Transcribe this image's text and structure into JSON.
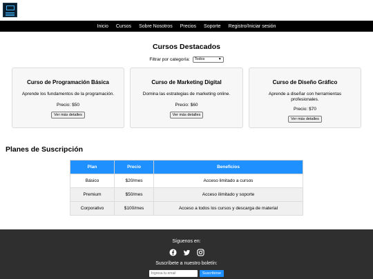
{
  "header": {
    "nav": [
      "Inicio",
      "Cursos",
      "Sobre Nosotros",
      "Precios",
      "Soporte",
      "Registro/Iniciar sesión"
    ]
  },
  "courses": {
    "title": "Cursos Destacados",
    "filter_label": "Filtrar por categoría:",
    "filter_value": "Todos",
    "cards": [
      {
        "title": "Curso de Programación Básica",
        "desc": "Aprende los fundamentos de la programación.",
        "price": "Precio: $50",
        "button": "Ver más detalles"
      },
      {
        "title": "Curso de Marketing Digital",
        "desc": "Domina las estrategias de marketing online.",
        "price": "Precio: $60",
        "button": "Ver más detalles"
      },
      {
        "title": "Curso de Diseño Gráfico",
        "desc": "Aprende a diseñar con herramientas profesionales.",
        "price": "Precio: $70",
        "button": "Ver más detalles"
      }
    ]
  },
  "plans": {
    "title": "Planes de Suscripción",
    "headers": [
      "Plan",
      "Precio",
      "Beneficios"
    ],
    "rows": [
      [
        "Básico",
        "$20/mes",
        "Acceso limitado a cursos"
      ],
      [
        "Premium",
        "$50/mes",
        "Acceso ilimitado y soporte"
      ],
      [
        "Corporativo",
        "$100/mes",
        "Acceso a todos los cursos y descarga de material"
      ]
    ]
  },
  "footer": {
    "follow": "Síguenos en:",
    "social_icons": [
      "facebook-icon",
      "twitter-icon",
      "instagram-icon"
    ],
    "subscribe": "Suscríbete a nuestro boletín:",
    "email_placeholder": "Ingresa tu email",
    "subscribe_button": "Suscribirse"
  },
  "colors": {
    "accent": "#1e90ff",
    "nav_bg": "#000000",
    "footer_bg": "#2f2f2f"
  }
}
